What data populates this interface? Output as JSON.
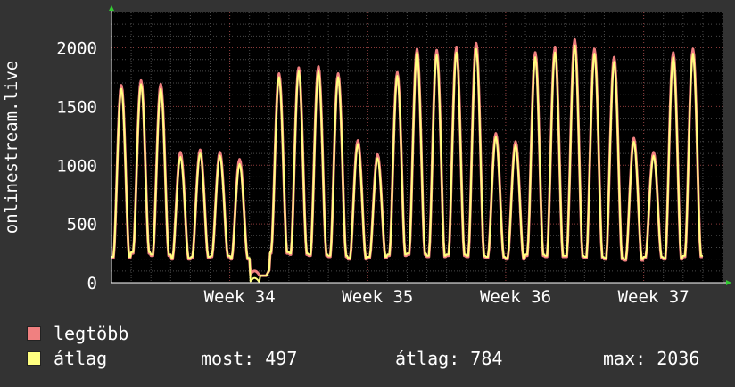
{
  "chart_data": {
    "type": "area",
    "ylabel": "onlinestream.live",
    "ylim": [
      0,
      2300
    ],
    "yticks": [
      0,
      500,
      1000,
      1500,
      2000
    ],
    "xlim": [
      0,
      31
    ],
    "xticks": [
      {
        "label": "Week 34",
        "x": 6.5
      },
      {
        "label": "Week 35",
        "x": 13.5
      },
      {
        "label": "Week 36",
        "x": 20.5
      },
      {
        "label": "Week 37",
        "x": 27.5
      }
    ],
    "grid": true,
    "legend_position": "bottom-left",
    "series": [
      {
        "name": "legtöbb",
        "color": "#f08080",
        "daily_peaks": [
          1680,
          1720,
          1690,
          1110,
          1130,
          1110,
          1050,
          0,
          1780,
          1830,
          1840,
          1780,
          1210,
          1090,
          1790,
          1990,
          1980,
          2000,
          2040,
          1270,
          1200,
          1960,
          2000,
          2070,
          1990,
          1920,
          1230,
          1110,
          1960,
          1990
        ],
        "daily_troughs": [
          210,
          250,
          230,
          200,
          210,
          220,
          200,
          60,
          250,
          240,
          230,
          220,
          200,
          210,
          230,
          240,
          220,
          230,
          220,
          210,
          200,
          230,
          220,
          220,
          210,
          200,
          190,
          210,
          200,
          220
        ]
      },
      {
        "name": "átlag",
        "color": "#ffff80",
        "daily_peaks": [
          1650,
          1690,
          1650,
          1070,
          1100,
          1080,
          1010,
          0,
          1750,
          1800,
          1800,
          1750,
          1180,
          1060,
          1760,
          1960,
          1940,
          1960,
          1990,
          1240,
          1170,
          1920,
          1960,
          2020,
          1950,
          1880,
          1200,
          1080,
          1920,
          1950
        ],
        "daily_troughs": [
          220,
          260,
          240,
          210,
          220,
          230,
          210,
          0,
          260,
          250,
          240,
          230,
          210,
          220,
          240,
          250,
          230,
          240,
          230,
          220,
          210,
          240,
          230,
          230,
          220,
          210,
          200,
          220,
          210,
          230
        ]
      }
    ]
  },
  "legend": {
    "max_label": "legtöbb",
    "avg_label": "átlag",
    "max_color": "#f08080",
    "avg_color": "#ffff80"
  },
  "stats": {
    "now": "most: 497",
    "avg": "átlag: 784",
    "max": "max: 2036"
  }
}
